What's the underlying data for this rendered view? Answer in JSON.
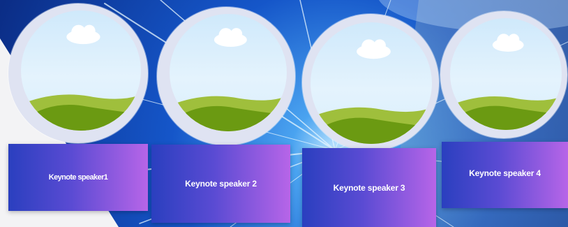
{
  "speakers": [
    {
      "name": "Keynote speaker1",
      "photo": "placeholder-landscape-image"
    },
    {
      "name": "Keynote speaker 2",
      "photo": "placeholder-landscape-image"
    },
    {
      "name": "Keynote speaker 3",
      "photo": "placeholder-landscape-image"
    },
    {
      "name": "Keynote speaker 4",
      "photo": "placeholder-landscape-image"
    }
  ],
  "colors": {
    "card_gradient_start": "#2a3fbf",
    "card_gradient_end": "#b765e8",
    "background_blue": "#1a5fd6",
    "ring": "#dfe3f2",
    "sky": "#cfe9fb",
    "hill_light": "#9fbf3c",
    "hill_dark": "#6b9a12"
  }
}
